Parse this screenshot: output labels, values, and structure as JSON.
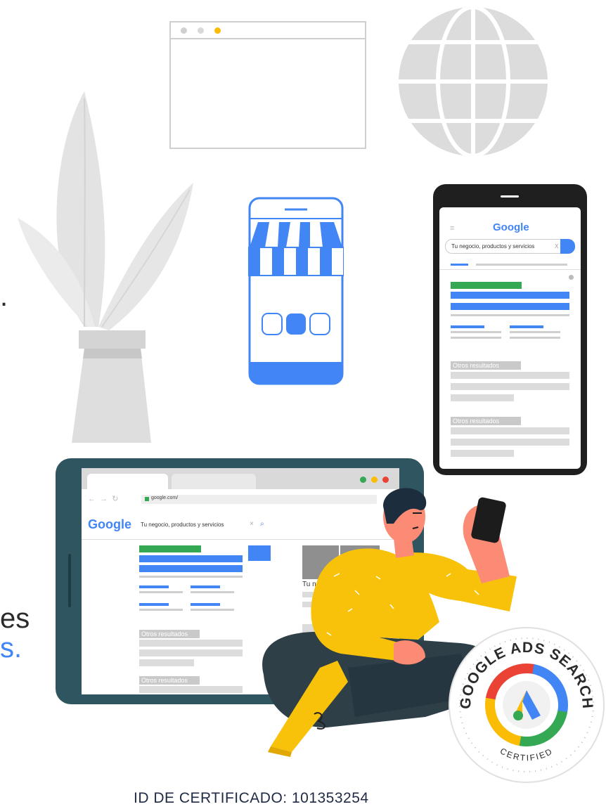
{
  "colors": {
    "google_blue": "#4285f4",
    "google_green": "#34a853",
    "google_yellow": "#fbbc05",
    "google_red": "#ea4335",
    "tablet_frame": "#2f5560",
    "shirt_yellow": "#f8c20a"
  },
  "phone": {
    "logo": "Google",
    "search_placeholder": "Tu negocio, productos y servicios",
    "clear": "X",
    "otros1": "Otros resultados",
    "otros2": "Otros resultados"
  },
  "tablet": {
    "url": "google.com/",
    "logo": "Google",
    "search_text": "Tu negocio, productos y servicios",
    "clear": "×",
    "side_label": "Tu negocio",
    "otros1": "Otros resultados",
    "otros2": "Otros resultados"
  },
  "badge": {
    "top_text": "GOOGLE ADS SEARCH",
    "bottom_text": "CERTIFIED"
  },
  "edge_text": {
    "a": ".",
    "b": "es",
    "c": "s."
  },
  "certificate_id": "ID DE CERTIFICADO: 101353254"
}
